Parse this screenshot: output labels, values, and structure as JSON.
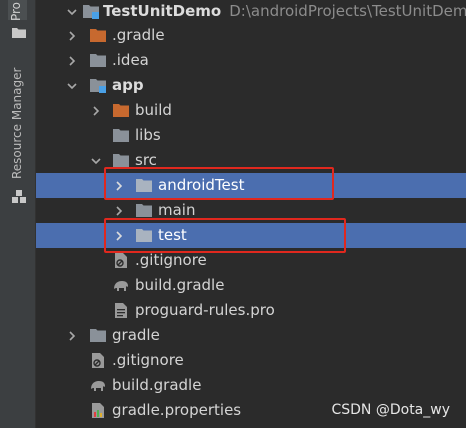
{
  "sidebar": {
    "project_tab": "Pro",
    "resource_manager": "Resource Manager"
  },
  "tree": {
    "root_name": "TestUnitDemo",
    "root_path": "D:\\androidProjects\\TestUnitDemo",
    "items": [
      {
        "label": ".gradle"
      },
      {
        "label": ".idea"
      },
      {
        "label": "app"
      },
      {
        "label": "build"
      },
      {
        "label": "libs"
      },
      {
        "label": "src"
      },
      {
        "label": "androidTest"
      },
      {
        "label": "main"
      },
      {
        "label": "test"
      },
      {
        "label": ".gitignore"
      },
      {
        "label": "build.gradle"
      },
      {
        "label": "proguard-rules.pro"
      },
      {
        "label": "gradle"
      },
      {
        "label": ".gitignore"
      },
      {
        "label": "build.gradle"
      },
      {
        "label": "gradle.properties"
      }
    ]
  },
  "watermark": "CSDN @Dota_wy",
  "colors": {
    "background": "#2b2b2b",
    "selection": "#4b6eaf",
    "highlight_box": "#e0281e",
    "folder_gray": "#8a9199",
    "folder_orange": "#c7692f",
    "folder_blue": "#6d9ce0"
  }
}
